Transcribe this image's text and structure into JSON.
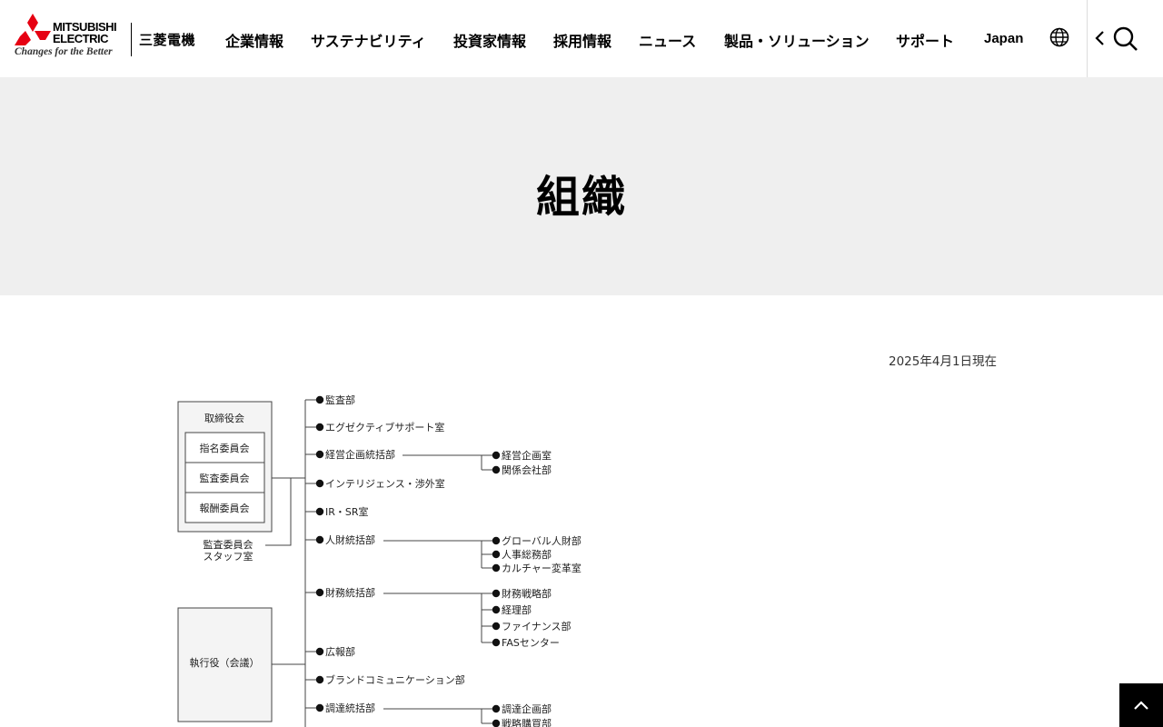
{
  "brand": {
    "line1": "MITSUBISHI",
    "line2": "ELECTRIC",
    "tagline": "Changes for the Better",
    "kanji": "三菱電機",
    "mark_color": "#e60012"
  },
  "nav": {
    "items": [
      "企業情報",
      "サステナビリティ",
      "投資家情報",
      "採用情報",
      "ニュース",
      "製品・ソリューション",
      "サポート"
    ],
    "lang": "Japan"
  },
  "hero": {
    "title": "組織"
  },
  "date": "2025年4月1日現在",
  "org": {
    "board": {
      "title": "取締役会",
      "committees": [
        "指名委員会",
        "監査委員会",
        "報酬委員会"
      ],
      "staff_line1": "監査委員会",
      "staff_line2": "スタッフ室"
    },
    "executive": "執行役（会議）",
    "departments": [
      {
        "name": "監査部",
        "children": []
      },
      {
        "name": "エグゼクティブサポート室",
        "children": []
      },
      {
        "name": "経営企画統括部",
        "children": [
          "経営企画室",
          "関係会社部"
        ]
      },
      {
        "name": "インテリジェンス・渉外室",
        "children": []
      },
      {
        "name": "IR・SR室",
        "children": []
      },
      {
        "name": "人財統括部",
        "children": [
          "グローバル人財部",
          "人事総務部",
          "カルチャー変革室"
        ]
      },
      {
        "name": "財務統括部",
        "children": [
          "財務戦略部",
          "経理部",
          "ファイナンス部",
          "FASセンター"
        ]
      },
      {
        "name": "広報部",
        "children": []
      },
      {
        "name": "ブランドコミュニケーション部",
        "children": []
      },
      {
        "name": "調達統括部",
        "children": [
          "調達企画部",
          "戦略購買部"
        ]
      }
    ]
  },
  "icons": [
    "globe-icon",
    "chevron-left-icon",
    "search-icon",
    "chevron-up-icon"
  ]
}
